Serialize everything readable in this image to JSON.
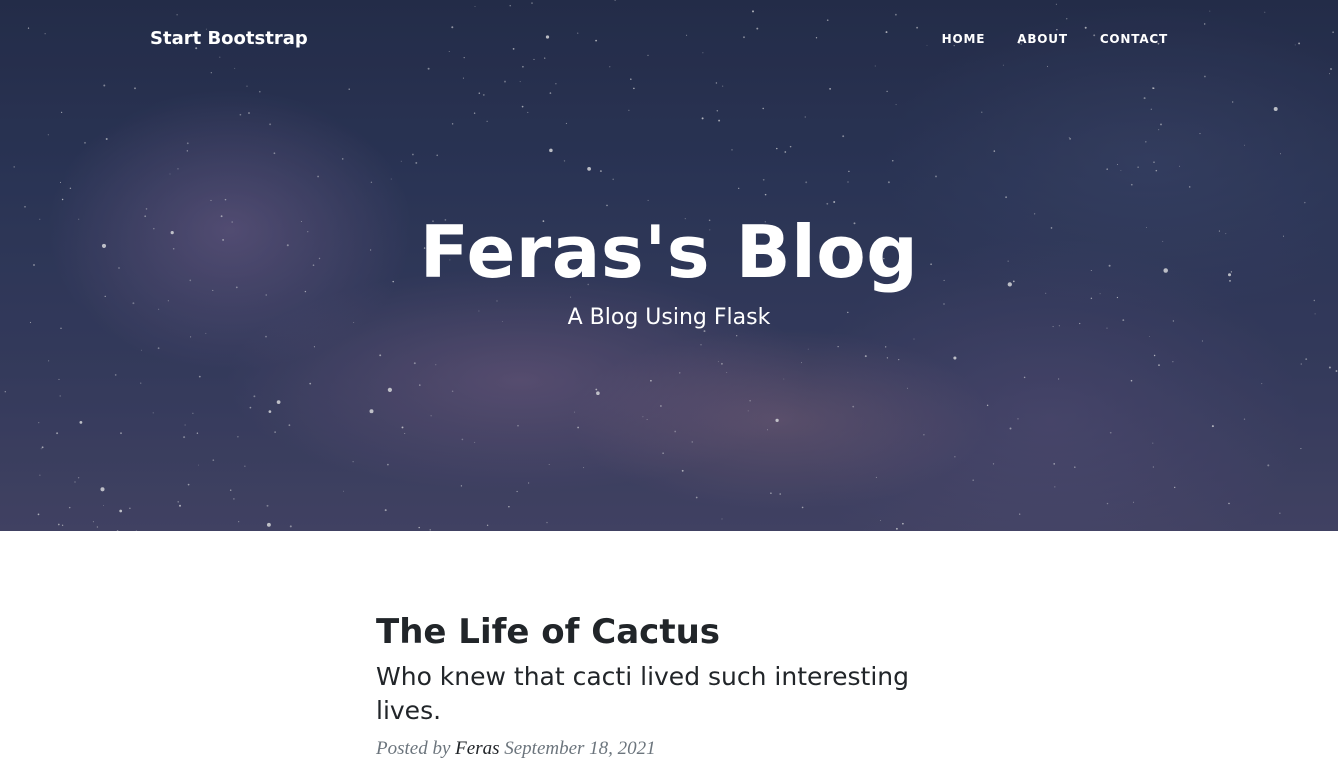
{
  "navbar": {
    "brand": "Start Bootstrap",
    "links": [
      "HOME",
      "ABOUT",
      "CONTACT"
    ]
  },
  "header": {
    "title": "Feras's Blog",
    "subtitle": "A Blog Using Flask"
  },
  "posts": [
    {
      "title": "The Life of Cactus",
      "subtitle": "Who knew that cacti lived such interesting lives.",
      "posted_by_label": "Posted by",
      "author": "Feras",
      "date": "September 18, 2021"
    }
  ],
  "colors": {
    "text": "#212529",
    "meta": "#6c757d",
    "hero_base": "#2f3a5e"
  }
}
